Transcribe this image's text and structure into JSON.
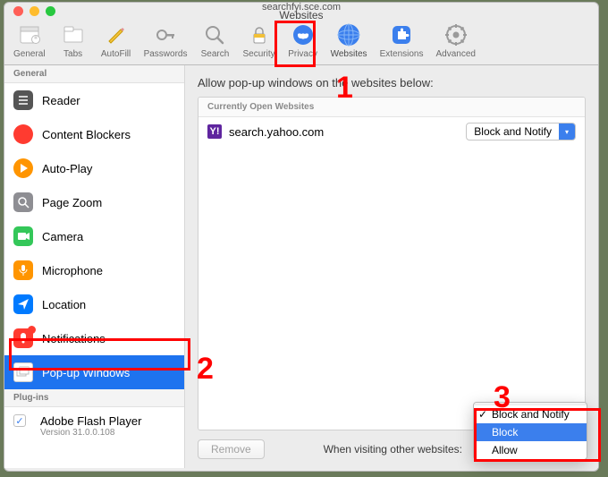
{
  "window": {
    "url": "searchfyi.sce.com",
    "title": "Websites"
  },
  "toolbar": {
    "general": "General",
    "tabs": "Tabs",
    "autofill": "AutoFill",
    "passwords": "Passwords",
    "search": "Search",
    "security": "Security",
    "privacy": "Privacy",
    "websites": "Websites",
    "extensions": "Extensions",
    "advanced": "Advanced"
  },
  "sidebar": {
    "general_header": "General",
    "items": {
      "reader": "Reader",
      "content_blockers": "Content Blockers",
      "auto_play": "Auto-Play",
      "page_zoom": "Page Zoom",
      "camera": "Camera",
      "microphone": "Microphone",
      "location": "Location",
      "notifications": "Notifications",
      "popup_windows": "Pop-up Windows"
    },
    "plugins_header": "Plug-ins",
    "plugin": {
      "name": "Adobe Flash Player",
      "version": "Version 31.0.0.108"
    }
  },
  "main": {
    "heading": "Allow pop-up windows on the websites below:",
    "panel_header": "Currently Open Websites",
    "site": {
      "domain": "search.yahoo.com",
      "policy": "Block and Notify"
    },
    "remove_btn": "Remove",
    "bottom_label": "When visiting other websites:"
  },
  "dropdown": {
    "block_notify": "Block and Notify",
    "block": "Block",
    "allow": "Allow"
  },
  "annotations": {
    "n1": "1",
    "n2": "2",
    "n3": "3"
  }
}
